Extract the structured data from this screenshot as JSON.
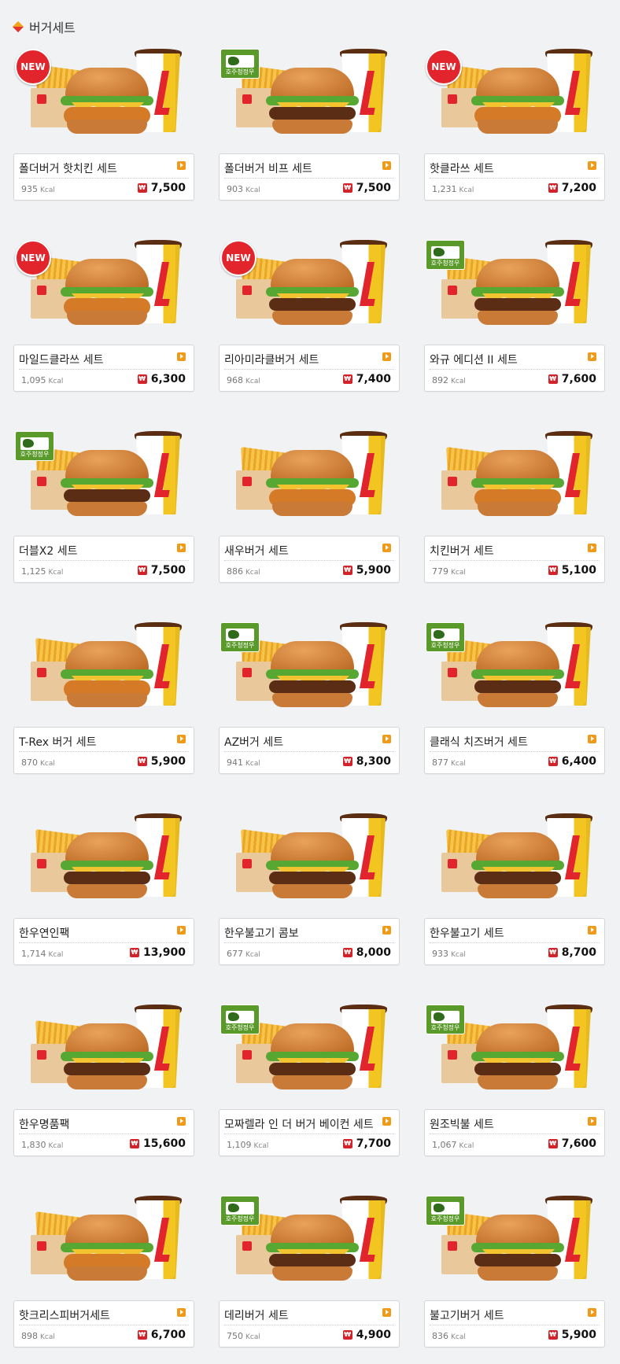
{
  "section": {
    "title": "버거세트",
    "icon": "diamond-icon"
  },
  "colors": {
    "accent": "#e2252c",
    "more": "#f09a1a",
    "aussie": "#5a9a2a"
  },
  "items": [
    {
      "name": "폴더버거 핫치킨 세트",
      "kcal": "935",
      "price": "7,500",
      "badge": "new",
      "patty": "chicken"
    },
    {
      "name": "폴더버거 비프 세트",
      "kcal": "903",
      "price": "7,500",
      "badge": "aussie",
      "patty": "beef"
    },
    {
      "name": "핫클라쓰 세트",
      "kcal": "1,231",
      "price": "7,200",
      "badge": "new",
      "patty": "chicken"
    },
    {
      "name": "마일드클라쓰 세트",
      "kcal": "1,095",
      "price": "6,300",
      "badge": "new",
      "patty": "chicken"
    },
    {
      "name": "리아미라클버거 세트",
      "kcal": "968",
      "price": "7,400",
      "badge": "new",
      "patty": "beef"
    },
    {
      "name": "와규 에디션 II 세트",
      "kcal": "892",
      "price": "7,600",
      "badge": "aussie",
      "patty": "beef"
    },
    {
      "name": "더블X2 세트",
      "kcal": "1,125",
      "price": "7,500",
      "badge": "aussie",
      "patty": "beef"
    },
    {
      "name": "새우버거 세트",
      "kcal": "886",
      "price": "5,900",
      "badge": "",
      "patty": "chicken"
    },
    {
      "name": "치킨버거 세트",
      "kcal": "779",
      "price": "5,100",
      "badge": "",
      "patty": "chicken"
    },
    {
      "name": "T-Rex 버거 세트",
      "kcal": "870",
      "price": "5,900",
      "badge": "",
      "patty": "chicken"
    },
    {
      "name": "AZ버거 세트",
      "kcal": "941",
      "price": "8,300",
      "badge": "aussie",
      "patty": "beef"
    },
    {
      "name": "클래식 치즈버거 세트",
      "kcal": "877",
      "price": "6,400",
      "badge": "aussie",
      "patty": "beef"
    },
    {
      "name": "한우연인팩",
      "kcal": "1,714",
      "price": "13,900",
      "badge": "",
      "patty": "beef"
    },
    {
      "name": "한우불고기 콤보",
      "kcal": "677",
      "price": "8,000",
      "badge": "",
      "patty": "beef"
    },
    {
      "name": "한우불고기 세트",
      "kcal": "933",
      "price": "8,700",
      "badge": "",
      "patty": "beef"
    },
    {
      "name": "한우명품팩",
      "kcal": "1,830",
      "price": "15,600",
      "badge": "",
      "patty": "beef"
    },
    {
      "name": "모짜렐라 인 더 버거 베이컨 세트",
      "kcal": "1,109",
      "price": "7,700",
      "badge": "aussie",
      "patty": "beef"
    },
    {
      "name": "원조빅불 세트",
      "kcal": "1,067",
      "price": "7,600",
      "badge": "aussie",
      "patty": "beef"
    },
    {
      "name": "핫크리스피버거세트",
      "kcal": "898",
      "price": "6,700",
      "badge": "",
      "patty": "chicken"
    },
    {
      "name": "데리버거 세트",
      "kcal": "750",
      "price": "4,900",
      "badge": "aussie",
      "patty": "beef"
    },
    {
      "name": "불고기버거 세트",
      "kcal": "836",
      "price": "5,900",
      "badge": "aussie",
      "patty": "beef"
    }
  ],
  "labels": {
    "kcal_unit": "Kcal",
    "new_badge": "NEW",
    "aussie_badge": "호주청정우",
    "currency": "₩"
  }
}
